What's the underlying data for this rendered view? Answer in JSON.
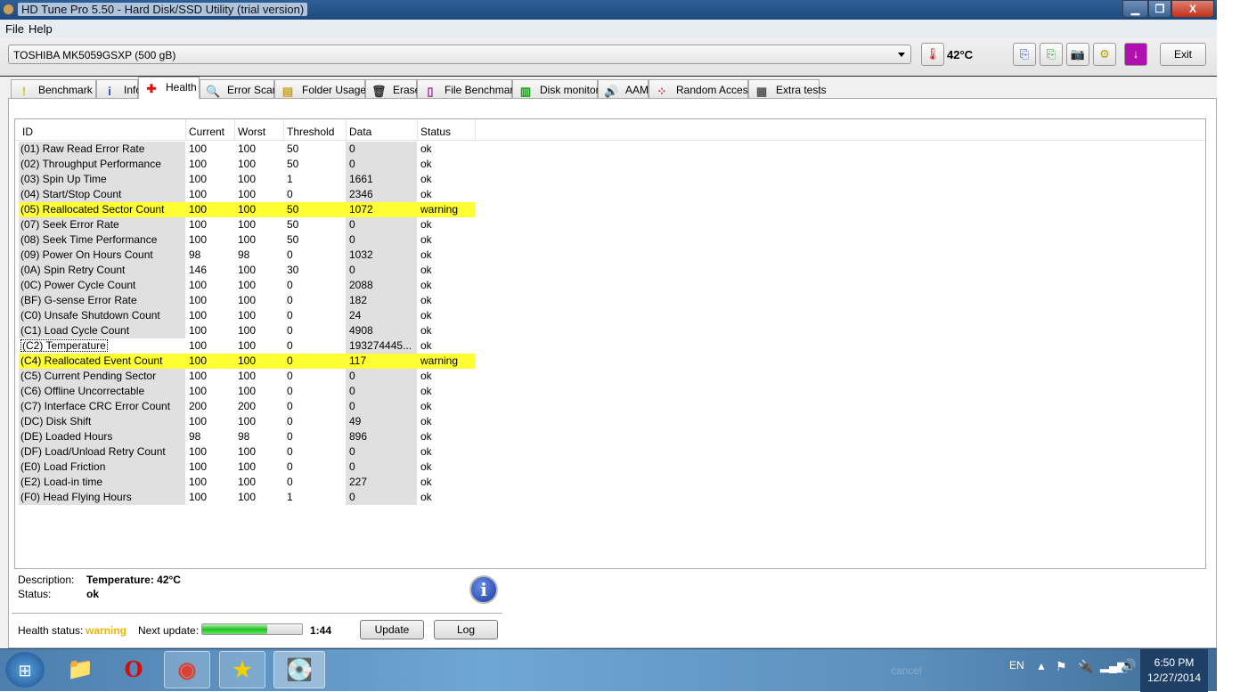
{
  "window": {
    "title": "HD Tune Pro 5.50 - Hard Disk/SSD Utility (trial version)",
    "minimize": "▁",
    "restore": "❐",
    "close": "X"
  },
  "menu": [
    "File",
    "Help"
  ],
  "toolbar": {
    "drive": "TOSHIBA MK5059GSXP (500 gB)",
    "temperature": "42°C",
    "exit": "Exit"
  },
  "tabs": [
    {
      "label": "Benchmark",
      "icon": "!",
      "color": "#d8c000"
    },
    {
      "label": "Info",
      "icon": "i",
      "color": "#1a50d0"
    },
    {
      "label": "Health",
      "icon": "✚",
      "color": "#e01010"
    },
    {
      "label": "Error Scan",
      "icon": "🔍",
      "color": "#208020"
    },
    {
      "label": "Folder Usage",
      "icon": "▤",
      "color": "#c8a020"
    },
    {
      "label": "Erase",
      "icon": "🗑",
      "color": "#333"
    },
    {
      "label": "File Benchmark",
      "icon": "▯",
      "color": "#a020a0"
    },
    {
      "label": "Disk monitor",
      "icon": "▥",
      "color": "#10a010"
    },
    {
      "label": "AAM",
      "icon": "🔊",
      "color": "#b09000"
    },
    {
      "label": "Random Access",
      "icon": "⁘",
      "color": "#c04040"
    },
    {
      "label": "Extra tests",
      "icon": "▦",
      "color": "#555"
    }
  ],
  "table": {
    "columns": [
      "ID",
      "Current",
      "Worst",
      "Threshold",
      "Data",
      "Status"
    ],
    "rows": [
      [
        "(01) Raw Read Error Rate",
        "100",
        "100",
        "50",
        "0",
        "ok"
      ],
      [
        "(02) Throughput Performance",
        "100",
        "100",
        "50",
        "0",
        "ok"
      ],
      [
        "(03) Spin Up Time",
        "100",
        "100",
        "1",
        "1661",
        "ok"
      ],
      [
        "(04) Start/Stop Count",
        "100",
        "100",
        "0",
        "2346",
        "ok"
      ],
      [
        "(05) Reallocated Sector Count",
        "100",
        "100",
        "50",
        "1072",
        "warning"
      ],
      [
        "(07) Seek Error Rate",
        "100",
        "100",
        "50",
        "0",
        "ok"
      ],
      [
        "(08) Seek Time Performance",
        "100",
        "100",
        "50",
        "0",
        "ok"
      ],
      [
        "(09) Power On Hours Count",
        "98",
        "98",
        "0",
        "1032",
        "ok"
      ],
      [
        "(0A) Spin Retry Count",
        "146",
        "100",
        "30",
        "0",
        "ok"
      ],
      [
        "(0C) Power Cycle Count",
        "100",
        "100",
        "0",
        "2088",
        "ok"
      ],
      [
        "(BF) G-sense Error Rate",
        "100",
        "100",
        "0",
        "182",
        "ok"
      ],
      [
        "(C0) Unsafe Shutdown Count",
        "100",
        "100",
        "0",
        "24",
        "ok"
      ],
      [
        "(C1) Load Cycle Count",
        "100",
        "100",
        "0",
        "4908",
        "ok"
      ],
      [
        "(C2) Temperature",
        "100",
        "100",
        "0",
        "193274445...",
        "ok"
      ],
      [
        "(C4) Reallocated Event Count",
        "100",
        "100",
        "0",
        "117",
        "warning"
      ],
      [
        "(C5) Current Pending Sector",
        "100",
        "100",
        "0",
        "0",
        "ok"
      ],
      [
        "(C6) Offline Uncorrectable",
        "100",
        "100",
        "0",
        "0",
        "ok"
      ],
      [
        "(C7) Interface CRC Error Count",
        "200",
        "200",
        "0",
        "0",
        "ok"
      ],
      [
        "(DC) Disk Shift",
        "100",
        "100",
        "0",
        "49",
        "ok"
      ],
      [
        "(DE) Loaded Hours",
        "98",
        "98",
        "0",
        "896",
        "ok"
      ],
      [
        "(DF) Load/Unload Retry Count",
        "100",
        "100",
        "0",
        "0",
        "ok"
      ],
      [
        "(E0) Load Friction",
        "100",
        "100",
        "0",
        "0",
        "ok"
      ],
      [
        "(E2) Load-in time",
        "100",
        "100",
        "0",
        "227",
        "ok"
      ],
      [
        "(F0) Head Flying Hours",
        "100",
        "100",
        "1",
        "0",
        "ok"
      ]
    ]
  },
  "details": {
    "description_label": "Description:",
    "description_prefix": "Temperature",
    "description_value": ": 42°C",
    "status_label": "Status:",
    "status_value": "ok"
  },
  "footer": {
    "health_label": "Health status:",
    "health_value": "warning",
    "next_update_label": "Next update:",
    "progress_percent": 65,
    "countdown": "1:44",
    "update": "Update",
    "log": "Log"
  },
  "colors": {
    "warning_row": "#ffff33",
    "warning_text": "#f0b400"
  },
  "taskbar": {
    "language": "EN",
    "time": "6:50 PM",
    "date": "12/27/2014",
    "ghost_button": "cancel"
  }
}
